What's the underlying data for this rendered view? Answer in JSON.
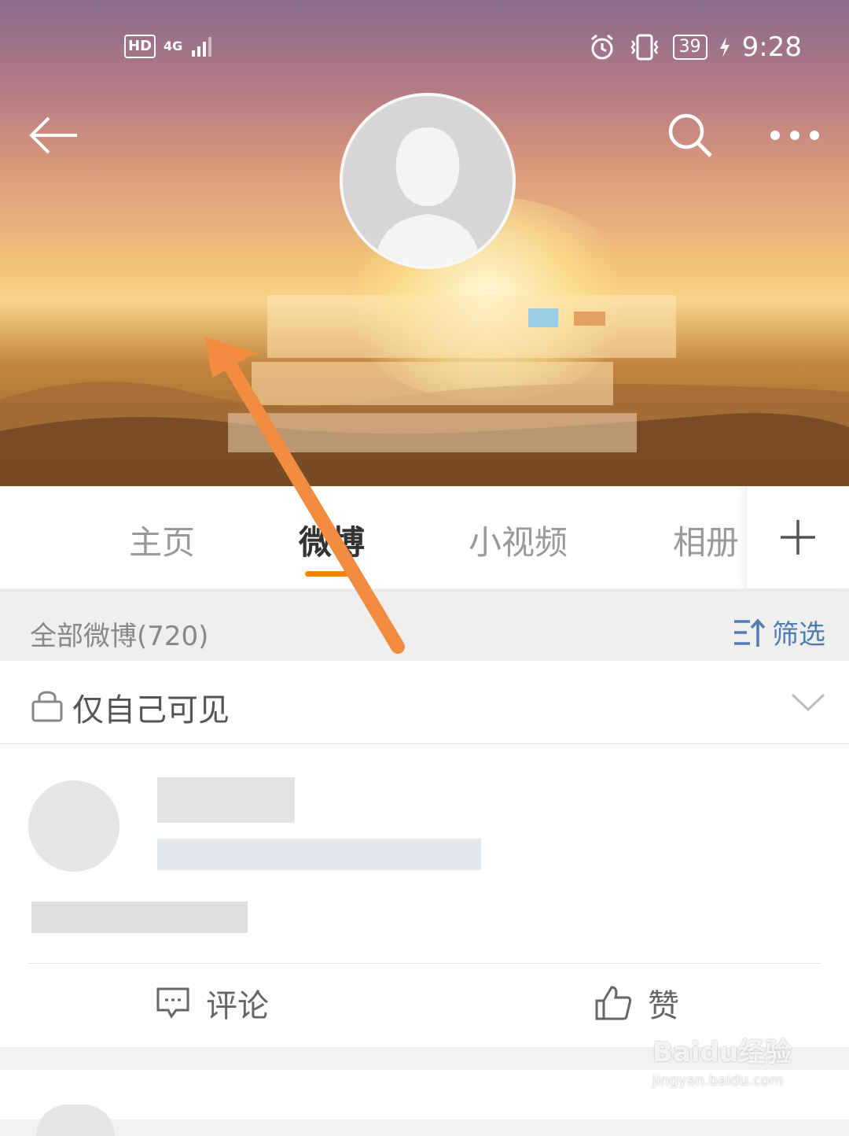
{
  "status_bar": {
    "hd_label": "HD",
    "network_label": "4G",
    "battery_level": "39",
    "time": "9:28"
  },
  "profile": {
    "tabs": [
      {
        "label": "主页"
      },
      {
        "label": "微博"
      },
      {
        "label": "小视频"
      },
      {
        "label": "相册"
      }
    ],
    "active_tab": "微博"
  },
  "feed": {
    "count_label": "全部微博(720)",
    "filter_label": "筛选",
    "visibility_label": "仅自己可见",
    "actions": {
      "comment_label": "评论",
      "like_label": "赞"
    }
  },
  "colors": {
    "accent": "#ff8200",
    "link": "#507daf",
    "annotation_arrow": "#f28c3f"
  },
  "watermark": {
    "main": "Baidu经验",
    "sub": "jingyan.baidu.com"
  }
}
